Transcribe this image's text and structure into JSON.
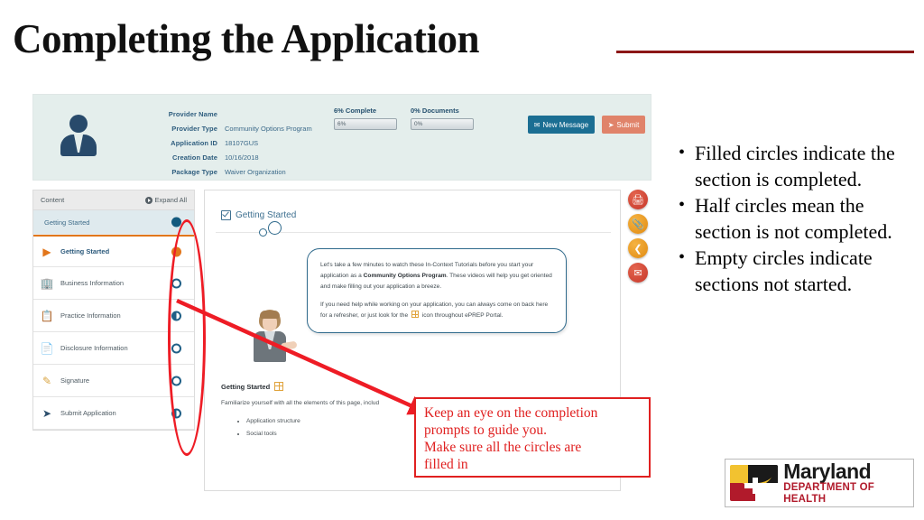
{
  "slide": {
    "title": "Completing the Application"
  },
  "app": {
    "header": {
      "fields": [
        {
          "label": "Provider Name",
          "value": ""
        },
        {
          "label": "Provider Type",
          "value": "Community Options Program"
        },
        {
          "label": "Application ID",
          "value": "18107GUS"
        },
        {
          "label": "Creation Date",
          "value": "10/16/2018"
        },
        {
          "label": "Package Type",
          "value": "Waiver Organization"
        }
      ],
      "progress": [
        {
          "title": "6% Complete",
          "value": "6%",
          "percent": 6
        },
        {
          "title": "0% Documents",
          "value": "0%",
          "percent": 0
        }
      ],
      "buttons": [
        {
          "label": "New Message",
          "icon": "envelope-icon",
          "color": "#1b6e93"
        },
        {
          "label": "Submit",
          "icon": "paper-plane-icon",
          "color": "#e0836a"
        }
      ]
    },
    "sidebar": {
      "title": "Content",
      "expand_all": "Expand All",
      "section": {
        "label": "Getting Started",
        "status": "filled"
      },
      "items": [
        {
          "label": "Getting Started",
          "icon": "triangle-right-icon",
          "status": "filled-orange",
          "active": true
        },
        {
          "label": "Business Information",
          "icon": "building-icon",
          "status": "empty",
          "active": false
        },
        {
          "label": "Practice Information",
          "icon": "clipboard-icon",
          "status": "half",
          "active": false
        },
        {
          "label": "Disclosure Information",
          "icon": "document-key-icon",
          "status": "empty",
          "active": false
        },
        {
          "label": "Signature",
          "icon": "pencil-icon",
          "status": "empty",
          "active": false
        },
        {
          "label": "Submit Application",
          "icon": "paper-plane-icon",
          "status": "half",
          "active": false
        }
      ]
    },
    "content": {
      "title": "Getting Started",
      "bubble": {
        "p1_a": "Let's take a few minutes to watch these In-Context Tutorials before you start your application as a ",
        "p1_b": "Community Options Program",
        "p1_c": ". These videos will help you get oriented and make filling out your application a breeze.",
        "p2_a": "If you need help while working on your application, you can always come on back here for a refresher, or just look for the ",
        "p2_b": " icon throughout ePREP Portal."
      },
      "section_heading": "Getting Started",
      "description": "Familiarize yourself with all the elements of this page, includ",
      "list": [
        "Application structure",
        "Social tools"
      ]
    },
    "social_rail": [
      {
        "icon": "printer-icon",
        "color": "#c6372a"
      },
      {
        "icon": "paperclip-icon",
        "color": "#e08a12"
      },
      {
        "icon": "share-icon",
        "color": "#e08a12"
      },
      {
        "icon": "envelope-icon",
        "color": "#c6372a"
      }
    ]
  },
  "annotations": {
    "callout_lines": [
      "Keep an eye on the completion",
      "prompts to guide you.",
      "Make sure all the circles are",
      "filled in"
    ],
    "callout_color": "#e02020",
    "oval_color": "#ee1c25"
  },
  "bullets": [
    "Filled circles indicate  the section is completed.",
    "Half circles mean the section is not completed.",
    "Empty circles indicate sections not started."
  ],
  "logo": {
    "name": "Maryland",
    "department": "DEPARTMENT OF HEALTH"
  }
}
